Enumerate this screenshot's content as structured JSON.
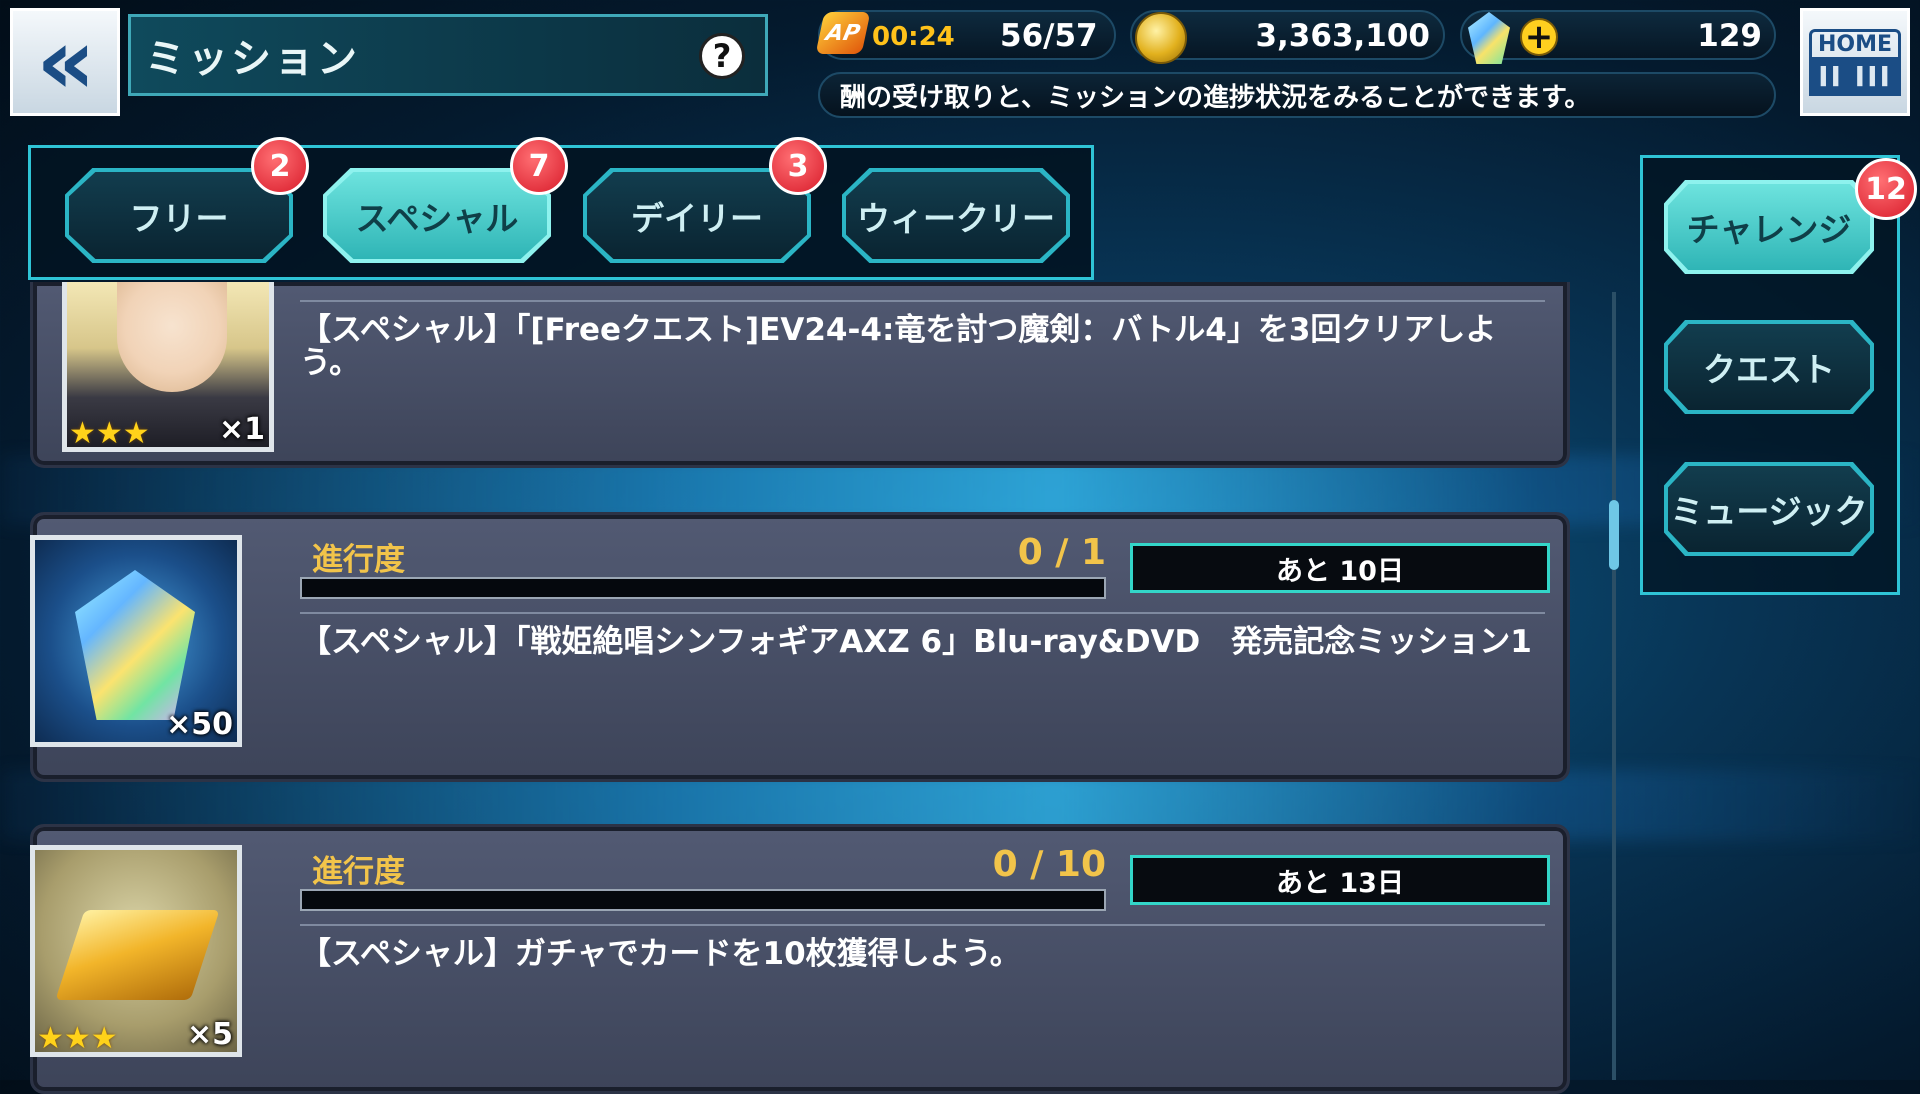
{
  "header": {
    "title": "ミッション",
    "help_label": "?",
    "home_label": "HOME",
    "home_bars": "II III",
    "back_glyph": "«",
    "info_text": "酬の受け取りと、ミッションの進捗状況をみることができます。"
  },
  "resources": {
    "ap_label": "AP",
    "ap_timer": "00:24",
    "ap_value": "56/57",
    "coins": "3,363,100",
    "gems": "129",
    "gem_plus": "+"
  },
  "tabs": [
    {
      "label": "フリー",
      "badge": "2",
      "active": false
    },
    {
      "label": "スペシャル",
      "badge": "7",
      "active": true
    },
    {
      "label": "デイリー",
      "badge": "3",
      "active": false
    },
    {
      "label": "ウィークリー",
      "badge": "",
      "active": false
    }
  ],
  "side_menu": [
    {
      "label": "チャレンジ",
      "badge": "12",
      "active": true
    },
    {
      "label": "クエスト",
      "active": false
    },
    {
      "label": "ミュージック",
      "active": false
    }
  ],
  "missions": [
    {
      "description": "【スペシャル】「[Freeクエスト]EV24-4:竜を討つ魔剣：バトル4」を3回クリアしよう。",
      "reward_icon": "character-card-icon",
      "reward_qty": "×1",
      "stars": "★★★"
    },
    {
      "progress_label": "進行度",
      "progress": "0 / 1",
      "progress_fraction": 0,
      "deadline": "あと 10日",
      "description": "【スペシャル】「戦姫絶唱シンフォギアAXZ 6」Blu-ray&DVD　発売記念ミッション1",
      "reward_icon": "rainbow-gem-icon",
      "reward_qty": "×50"
    },
    {
      "progress_label": "進行度",
      "progress": "0 / 10",
      "progress_fraction": 0,
      "deadline": "あと 13日",
      "description": "【スペシャル】ガチャでカードを10枚獲得しよう。",
      "reward_icon": "gold-bar-icon",
      "reward_qty": "×5",
      "stars": "★★★"
    }
  ],
  "colors": {
    "accent": "#2fc4d6",
    "progress_text": "#f2c44a",
    "badge": "#d81b2a"
  }
}
